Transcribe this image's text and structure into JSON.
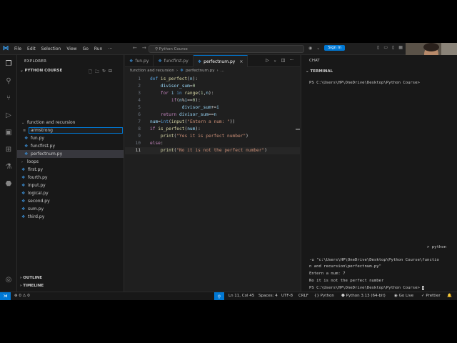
{
  "title_bar": {
    "menu": [
      "File",
      "Edit",
      "Selection",
      "View",
      "Go",
      "Run",
      "···"
    ],
    "command_center": "Python Course",
    "sign_in": "Sign In"
  },
  "sidebar": {
    "title": "EXPLORER",
    "section": "PYTHON COURSE",
    "tree": [
      {
        "label": "function and recursion",
        "type": "folder"
      },
      {
        "label": "armstrong",
        "type": "editing"
      },
      {
        "label": "fun.py",
        "type": "file"
      },
      {
        "label": "funcfirst.py",
        "type": "file"
      },
      {
        "label": "perfectnum.py",
        "type": "file-selected"
      },
      {
        "label": "loops",
        "type": "folder-collapsed"
      },
      {
        "label": "first.py",
        "type": "file"
      },
      {
        "label": "fourth.py",
        "type": "file"
      },
      {
        "label": "input.py",
        "type": "file"
      },
      {
        "label": "logical.py",
        "type": "file"
      },
      {
        "label": "second.py",
        "type": "file"
      },
      {
        "label": "sum.py",
        "type": "file"
      },
      {
        "label": "third.py",
        "type": "file"
      }
    ],
    "outline": "OUTLINE",
    "timeline": "TIMELINE"
  },
  "tabs": [
    {
      "label": "fun.py",
      "active": false
    },
    {
      "label": "funcfirst.py",
      "active": false
    },
    {
      "label": "perfectnum.py",
      "active": true
    }
  ],
  "breadcrumb": [
    "function and recursion",
    "›",
    "perfectnum.py",
    "›",
    "..."
  ],
  "code": {
    "line_numbers": [
      "1",
      "2",
      "3",
      "4",
      "5",
      "6",
      "7",
      "8",
      "9",
      "10",
      "11"
    ],
    "lines": [
      [
        [
          "kw2",
          "def "
        ],
        [
          "fn",
          "is_perfect"
        ],
        [
          "op",
          "("
        ],
        [
          "var",
          "n"
        ],
        [
          "op",
          "):"
        ]
      ],
      [
        [
          "op",
          "    "
        ],
        [
          "var",
          "divisor_sum"
        ],
        [
          "op",
          "="
        ],
        [
          "num",
          "0"
        ]
      ],
      [
        [
          "op",
          "    "
        ],
        [
          "kw",
          "for "
        ],
        [
          "var",
          "i"
        ],
        [
          "kw2",
          " in "
        ],
        [
          "fn",
          "range"
        ],
        [
          "op",
          "("
        ],
        [
          "num",
          "1"
        ],
        [
          "op",
          ","
        ],
        [
          "var",
          "n"
        ],
        [
          "op",
          "):"
        ]
      ],
      [
        [
          "op",
          "        "
        ],
        [
          "kw",
          "if"
        ],
        [
          "op",
          "("
        ],
        [
          "var",
          "n"
        ],
        [
          "op",
          "%"
        ],
        [
          "var",
          "i"
        ],
        [
          "op",
          "=="
        ],
        [
          "num",
          "0"
        ],
        [
          "op",
          "):"
        ]
      ],
      [
        [
          "op",
          "            "
        ],
        [
          "var",
          "divisor_sum"
        ],
        [
          "op",
          "+="
        ],
        [
          "var",
          "i"
        ]
      ],
      [
        [
          "op",
          "    "
        ],
        [
          "kw",
          "return "
        ],
        [
          "var",
          "divisor_sum"
        ],
        [
          "op",
          "=="
        ],
        [
          "var",
          "n"
        ]
      ],
      [
        [
          "var",
          "num"
        ],
        [
          "op",
          "="
        ],
        [
          "kw2",
          "int"
        ],
        [
          "op",
          "("
        ],
        [
          "fn",
          "input"
        ],
        [
          "op",
          "("
        ],
        [
          "str",
          "\"Entern a num: \""
        ],
        [
          "op",
          "))"
        ]
      ],
      [
        [
          "kw",
          "if "
        ],
        [
          "fn",
          "is_perfect"
        ],
        [
          "op",
          "("
        ],
        [
          "var",
          "num"
        ],
        [
          "op",
          "):"
        ]
      ],
      [
        [
          "op",
          "    "
        ],
        [
          "fn",
          "print"
        ],
        [
          "op",
          "("
        ],
        [
          "str",
          "\"Yes it is perfect number\""
        ],
        [
          "op",
          ")"
        ]
      ],
      [
        [
          "kw",
          "else"
        ],
        [
          "op",
          ":"
        ]
      ],
      [
        [
          "op",
          "    "
        ],
        [
          "fn",
          "print"
        ],
        [
          "op",
          "("
        ],
        [
          "str",
          "\"No it is not the perfect number\""
        ],
        [
          "op",
          ")"
        ]
      ]
    ]
  },
  "right_panel": {
    "chat_header": "CHAT",
    "terminal_header": "TERMINAL",
    "prompt_first": "PS C:\\Users\\HP\\OneDrive\\Desktop\\Python Course>",
    "python_cmd": "> python",
    "terminal_lines": [
      "-u \"c:\\Users\\HP\\OneDrive\\Desktop\\Python Course\\functio",
      "n and recursion\\perfectnum.py\"",
      "Entern a num: 7",
      "No it is not the perfect number",
      "PS C:\\Users\\HP\\OneDrive\\Desktop\\Python Course> "
    ],
    "chat_footer": "CHAT"
  },
  "status_bar": {
    "errors": "0",
    "warnings": "0",
    "position": "Ln 11, Col 45",
    "spaces": "Spaces: 4",
    "encoding": "UTF-8",
    "eol": "CRLF",
    "language": "Python",
    "interpreter": "Python 3.13 (64-bit)",
    "go_live": "Go Live",
    "prettier": "Prettier"
  },
  "colors": {
    "accent": "#0078d4",
    "editor_bg": "#1f1f1f",
    "sidebar_bg": "#181818"
  }
}
